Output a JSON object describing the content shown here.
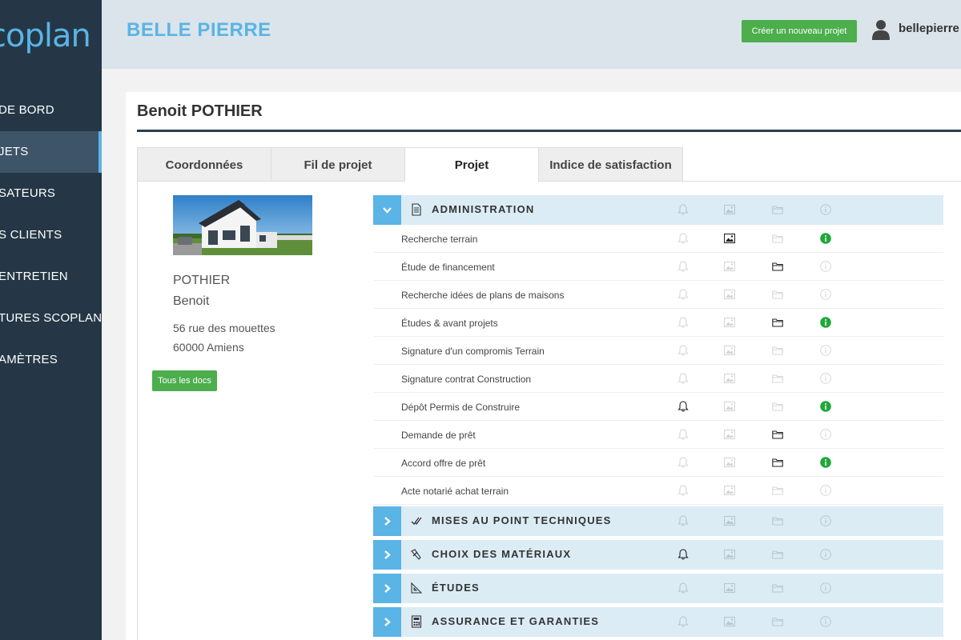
{
  "sidebar": {
    "logo": "coplan",
    "items": [
      {
        "label": "DE BORD",
        "active": false
      },
      {
        "label": "JETS",
        "active": true
      },
      {
        "label": "SATEURS",
        "active": false
      },
      {
        "label": "S CLIENTS",
        "active": false
      },
      {
        "label": "ENTRETIEN",
        "active": false
      },
      {
        "label": "TURES SCOPLAN",
        "active": false
      },
      {
        "label": "AMÈTRES",
        "active": false
      }
    ]
  },
  "header": {
    "brand": "BELLE PIERRE",
    "new_project_label": "Créer un nouveau projet",
    "username": "bellepierre ."
  },
  "client": {
    "name": "Benoit POTHIER",
    "last_name": "POTHIER",
    "first_name": "Benoit",
    "address_line1": "56 rue des mouettes",
    "address_line2": "60000 Amiens",
    "docs_button": "Tous les docs"
  },
  "tabs": [
    {
      "label": "Coordonnées",
      "active": false
    },
    {
      "label": "Fil de projet",
      "active": false
    },
    {
      "label": "Projet",
      "active": true
    },
    {
      "label": "Indice de satisfaction",
      "active": false
    }
  ],
  "sections": [
    {
      "title": "ADMINISTRATION",
      "icon": "document-icon",
      "open": true,
      "header_flags": {
        "bell": false,
        "image": false,
        "folder": false,
        "info": false
      },
      "rows": [
        {
          "label": "Recherche terrain",
          "bell": false,
          "image": true,
          "folder": false,
          "info": true
        },
        {
          "label": "Étude de financement",
          "bell": false,
          "image": false,
          "folder": true,
          "info": false
        },
        {
          "label": "Recherche idées de plans de maisons",
          "bell": false,
          "image": false,
          "folder": false,
          "info": false
        },
        {
          "label": "Études & avant projets",
          "bell": false,
          "image": false,
          "folder": true,
          "info": true
        },
        {
          "label": "Signature d'un compromis Terrain",
          "bell": false,
          "image": false,
          "folder": false,
          "info": false
        },
        {
          "label": "Signature contrat Construction",
          "bell": false,
          "image": false,
          "folder": false,
          "info": false
        },
        {
          "label": "Dépôt Permis de Construire",
          "bell": true,
          "image": false,
          "folder": false,
          "info": true
        },
        {
          "label": "Demande de prêt",
          "bell": false,
          "image": false,
          "folder": true,
          "info": false
        },
        {
          "label": "Accord offre de prêt",
          "bell": false,
          "image": false,
          "folder": true,
          "info": true
        },
        {
          "label": "Acte notarié achat terrain",
          "bell": false,
          "image": false,
          "folder": false,
          "info": false
        }
      ]
    },
    {
      "title": "MISES AU POINT TECHNIQUES",
      "icon": "checkmark-icon",
      "open": false,
      "header_flags": {
        "bell": false,
        "image": false,
        "folder": false,
        "info": false
      }
    },
    {
      "title": "CHOIX DES MATÉRIAUX",
      "icon": "tools-icon",
      "open": false,
      "header_flags": {
        "bell": true,
        "image": false,
        "folder": false,
        "info": false
      }
    },
    {
      "title": "ÉTUDES",
      "icon": "set-square-icon",
      "open": false,
      "header_flags": {
        "bell": false,
        "image": false,
        "folder": false,
        "info": false
      }
    },
    {
      "title": "ASSURANCE ET GARANTIES",
      "icon": "calculator-icon",
      "open": false,
      "header_flags": {
        "bell": false,
        "image": false,
        "folder": false,
        "info": false
      }
    }
  ],
  "colors": {
    "sidebar_bg": "#253746",
    "accent": "#5ab4e5",
    "header_bg": "#dae4ea",
    "green": "#4cae4c",
    "info_green": "#21a838"
  }
}
